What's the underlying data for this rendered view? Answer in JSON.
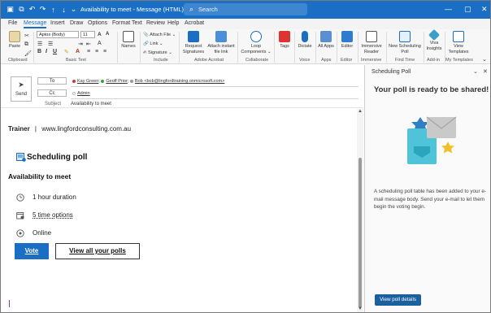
{
  "window": {
    "title": "Availability to meet  -  Message (HTML)",
    "search_placeholder": "Search"
  },
  "menu": [
    "File",
    "Message",
    "Insert",
    "Draw",
    "Options",
    "Format Text",
    "Review",
    "Help",
    "Acrobat"
  ],
  "ribbon": {
    "paste": "Paste",
    "font_name": "Aptos (Body)",
    "font_size": "11",
    "names": "Names",
    "attach_file": "Attach File",
    "link": "Link",
    "signature": "Signature",
    "request_signatures": "Request Signatures",
    "attach_instant": "Attach instant file link",
    "loop_components": "Loop Components",
    "tags": "Tags",
    "dictate": "Dictate",
    "all_apps": "All Apps",
    "editor": "Editor",
    "immersive_reader": "Immersive Reader",
    "new_scheduling_poll": "New Scheduling Poll",
    "viva_insights": "Viva Insights",
    "view_templates": "View Templates",
    "groups": {
      "clipboard": "Clipboard",
      "basic_text": "Basic Text",
      "include": "Include",
      "adobe_acrobat": "Adobe Acrobat",
      "collaborate": "Collaborate",
      "voice": "Voice",
      "apps": "Apps",
      "editor": "Editor",
      "immersive": "Immersive",
      "find_time": "Find Time",
      "add_in": "Add-in",
      "my_templates": "My Templates"
    }
  },
  "compose": {
    "send": "Send",
    "to_label": "To",
    "cc_label": "Cc",
    "subject_label": "Subject",
    "subject_value": "Availability to meet",
    "to_recipients": [
      {
        "name": "Kay Green",
        "color": "#d23a3a"
      },
      {
        "name": "Geoff Prior",
        "color": "#3aa53a"
      },
      {
        "name": "Bob <bob@lingfordtraining.onmicrosoft.com>",
        "color": "#999999"
      }
    ],
    "cc_recipients": [
      {
        "name": "Admin",
        "color": "#bbbbbb"
      }
    ]
  },
  "body": {
    "trainer_label": "Trainer",
    "trainer_sep": "|",
    "trainer_site": "www.lingfordconsulting.com.au",
    "poll_title": "Scheduling poll",
    "availability": "Availability to meet",
    "options": [
      {
        "icon": "clock-icon",
        "text": "1 hour duration"
      },
      {
        "icon": "calendar-icon",
        "text": "5 time options"
      },
      {
        "icon": "location-icon",
        "text": "Online"
      }
    ],
    "vote": "Vote",
    "view_all": "View all your polls"
  },
  "pane": {
    "title": "Scheduling Poll",
    "heading": "Your poll is ready to be shared!",
    "description": "A scheduling poll table has been added to your e-mail message body. Send your e-mail to let them begin the voting begin.",
    "view_details": "View poll details"
  },
  "colors": {
    "accent": "#1a6fc4",
    "pane_button": "#1a5f9e"
  }
}
